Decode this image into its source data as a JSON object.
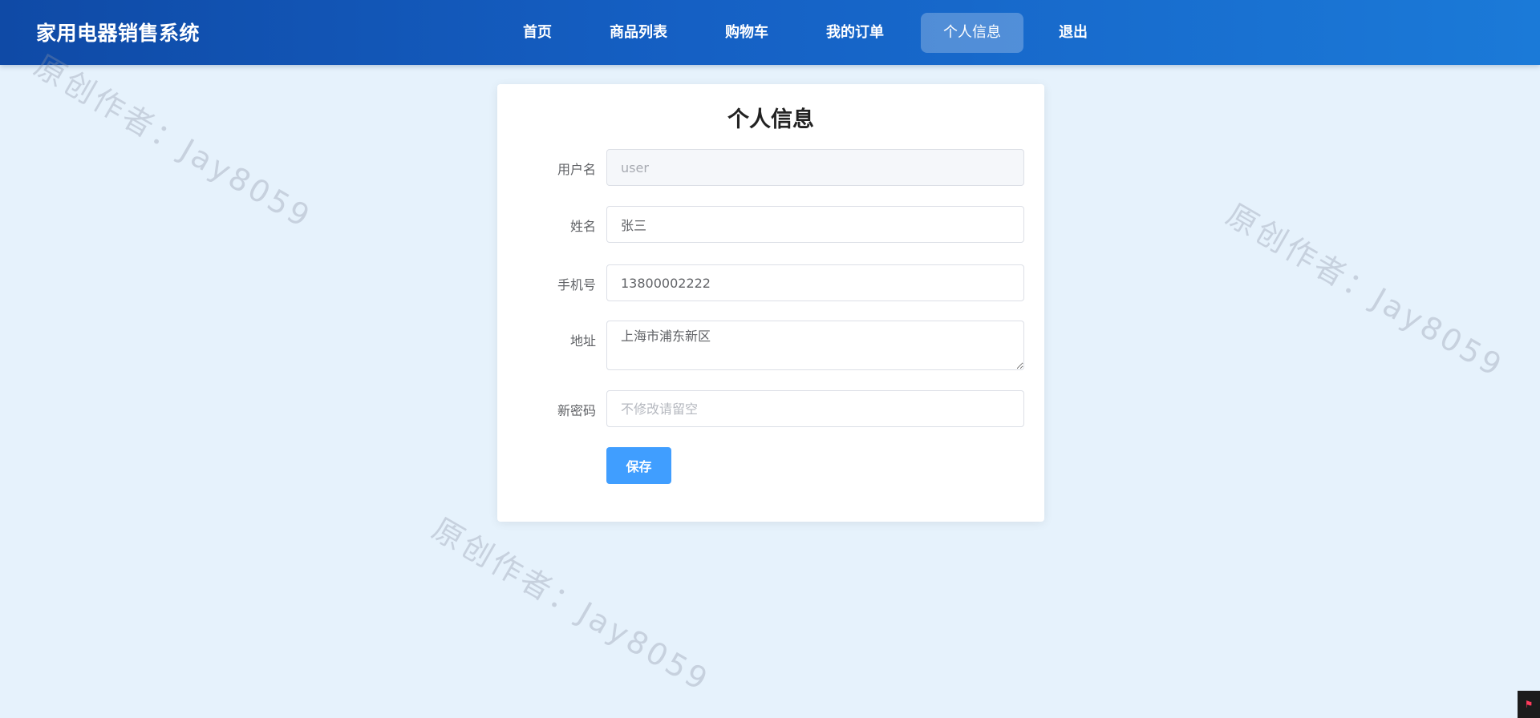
{
  "header": {
    "title": "家用电器销售系统",
    "nav": [
      {
        "label": "首页"
      },
      {
        "label": "商品列表"
      },
      {
        "label": "购物车"
      },
      {
        "label": "我的订单"
      },
      {
        "label": "个人信息",
        "active": true
      },
      {
        "label": "退出"
      }
    ]
  },
  "watermark": {
    "text": "原创作者：Jay8059"
  },
  "profile_form": {
    "title": "个人信息",
    "username_label": "用户名",
    "username_value": "user",
    "name_label": "姓名",
    "name_value": "张三",
    "phone_label": "手机号",
    "phone_value": "13800002222",
    "address_label": "地址",
    "address_value": "上海市浦东新区",
    "password_label": "新密码",
    "password_value": "",
    "password_placeholder": "不修改请留空",
    "save_label": "保存"
  },
  "colors": {
    "header_start": "#0f4aa6",
    "header_end": "#1b7ad8",
    "background": "#e6f2fc",
    "primary_button": "#409eff"
  }
}
